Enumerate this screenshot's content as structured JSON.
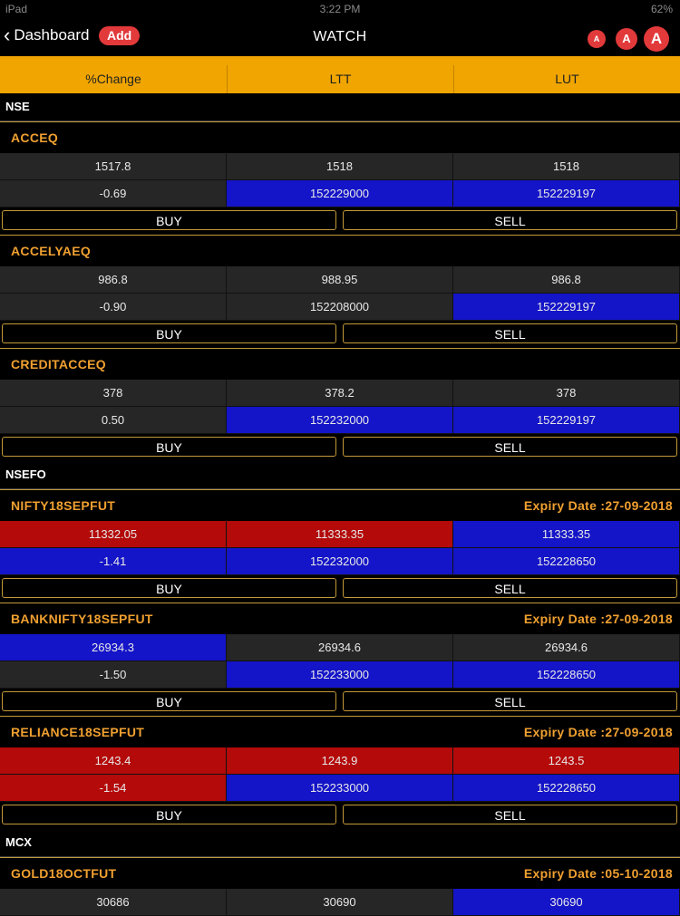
{
  "status": {
    "left": "iPad",
    "time": "3:22 PM",
    "battery": "62%"
  },
  "nav": {
    "back_label": "Dashboard",
    "add_label": "Add",
    "title": "WATCH",
    "font_small": "A",
    "font_medium": "A",
    "font_large": "A"
  },
  "columns": [
    "%Change",
    "LTT",
    "LUT"
  ],
  "groups": [
    {
      "exchange": "NSE",
      "items": [
        {
          "symbol": "ACCEQ",
          "expiry": "",
          "row1": [
            {
              "v": "1517.8",
              "c": "gray"
            },
            {
              "v": "1518",
              "c": "gray"
            },
            {
              "v": "1518",
              "c": "gray"
            }
          ],
          "row2": [
            {
              "v": "-0.69",
              "c": "gray"
            },
            {
              "v": "152229000",
              "c": "blue"
            },
            {
              "v": "152229197",
              "c": "blue"
            }
          ]
        },
        {
          "symbol": "ACCELYAEQ",
          "expiry": "",
          "row1": [
            {
              "v": "986.8",
              "c": "gray"
            },
            {
              "v": "988.95",
              "c": "gray"
            },
            {
              "v": "986.8",
              "c": "gray"
            }
          ],
          "row2": [
            {
              "v": "-0.90",
              "c": "gray"
            },
            {
              "v": "152208000",
              "c": "gray"
            },
            {
              "v": "152229197",
              "c": "blue"
            }
          ]
        },
        {
          "symbol": "CREDITACCEQ",
          "expiry": "",
          "row1": [
            {
              "v": "378",
              "c": "gray"
            },
            {
              "v": "378.2",
              "c": "gray"
            },
            {
              "v": "378",
              "c": "gray"
            }
          ],
          "row2": [
            {
              "v": "0.50",
              "c": "gray"
            },
            {
              "v": "152232000",
              "c": "blue"
            },
            {
              "v": "152229197",
              "c": "blue"
            }
          ]
        }
      ]
    },
    {
      "exchange": "NSEFO",
      "items": [
        {
          "symbol": "NIFTY18SEPFUT",
          "expiry": "Expiry Date :27-09-2018",
          "row1": [
            {
              "v": "11332.05",
              "c": "red"
            },
            {
              "v": "11333.35",
              "c": "red"
            },
            {
              "v": "11333.35",
              "c": "blue"
            }
          ],
          "row2": [
            {
              "v": "-1.41",
              "c": "blue"
            },
            {
              "v": "152232000",
              "c": "blue"
            },
            {
              "v": "152228650",
              "c": "blue"
            }
          ]
        },
        {
          "symbol": "BANKNIFTY18SEPFUT",
          "expiry": "Expiry Date :27-09-2018",
          "row1": [
            {
              "v": "26934.3",
              "c": "blue"
            },
            {
              "v": "26934.6",
              "c": "gray"
            },
            {
              "v": "26934.6",
              "c": "gray"
            }
          ],
          "row2": [
            {
              "v": "-1.50",
              "c": "gray"
            },
            {
              "v": "152233000",
              "c": "blue"
            },
            {
              "v": "152228650",
              "c": "blue"
            }
          ]
        },
        {
          "symbol": "RELIANCE18SEPFUT",
          "expiry": "Expiry Date :27-09-2018",
          "row1": [
            {
              "v": "1243.4",
              "c": "red"
            },
            {
              "v": "1243.9",
              "c": "red"
            },
            {
              "v": "1243.5",
              "c": "red"
            }
          ],
          "row2": [
            {
              "v": "-1.54",
              "c": "red"
            },
            {
              "v": "152233000",
              "c": "blue"
            },
            {
              "v": "152228650",
              "c": "blue"
            }
          ]
        }
      ]
    },
    {
      "exchange": "MCX",
      "items": [
        {
          "symbol": "GOLD18OCTFUT",
          "expiry": "Expiry Date :05-10-2018",
          "row1": [
            {
              "v": "30686",
              "c": "gray"
            },
            {
              "v": "30690",
              "c": "gray"
            },
            {
              "v": "30690",
              "c": "blue"
            }
          ],
          "row2": []
        }
      ]
    }
  ],
  "buy_label": "BUY",
  "sell_label": "SELL",
  "colors": {
    "accent": "#f0a500",
    "blue": "#1414c8",
    "red": "#b40a0a",
    "gray": "#262626",
    "badge": "#e2393a"
  }
}
